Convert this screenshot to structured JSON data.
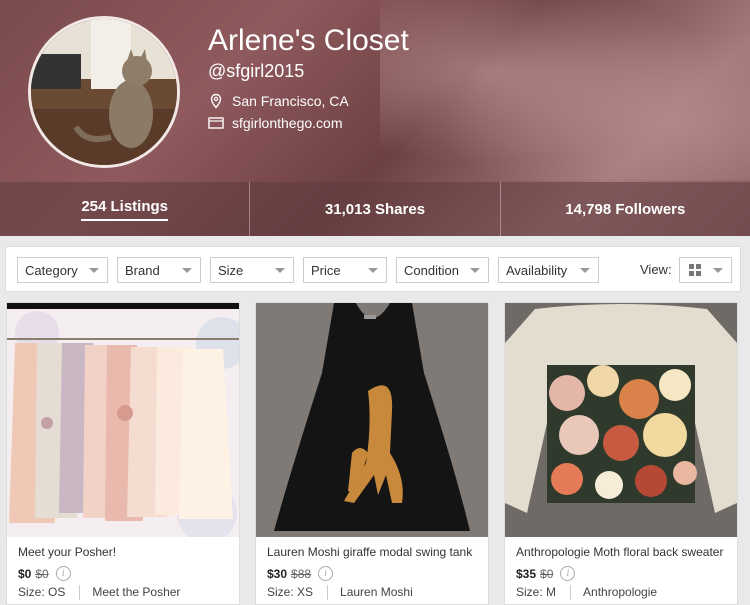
{
  "profile": {
    "title": "Arlene's Closet",
    "handle": "@sfgirl2015",
    "location": "San Francisco, CA",
    "website": "sfgirlonthego.com",
    "icons": {
      "location": "map-pin-icon",
      "website": "browser-window-icon"
    }
  },
  "stats": [
    {
      "label": "254 Listings",
      "active": true
    },
    {
      "label": "31,013 Shares",
      "active": false
    },
    {
      "label": "14,798 Followers",
      "active": false
    }
  ],
  "filters": {
    "items": [
      "Category",
      "Brand",
      "Size",
      "Price",
      "Condition",
      "Availability"
    ],
    "view_label": "View:",
    "view_icon": "grid-view-icon"
  },
  "listings": [
    {
      "title": "Meet your Posher!",
      "price": "$0",
      "original_price": "$0",
      "size": "Size: OS",
      "brand": "Meet the Posher"
    },
    {
      "title": "Lauren Moshi giraffe modal swing tank",
      "price": "$30",
      "original_price": "$88",
      "size": "Size: XS",
      "brand": "Lauren Moshi"
    },
    {
      "title": "Anthropologie Moth floral back sweater",
      "price": "$35",
      "original_price": "$0",
      "size": "Size: M",
      "brand": "Anthropologie"
    }
  ],
  "colors": {
    "header": "#7a4a4c",
    "accent": "#ffffff"
  }
}
